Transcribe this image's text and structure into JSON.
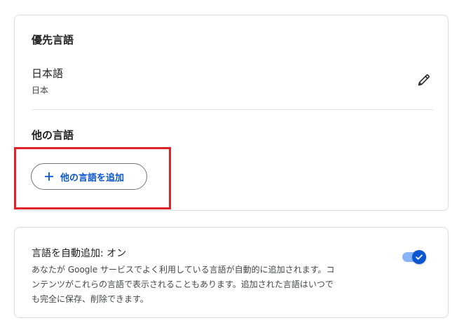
{
  "preferred": {
    "title": "優先言語",
    "language": "日本語",
    "region": "日本",
    "edit_icon": "pencil-icon"
  },
  "other": {
    "title": "他の言語",
    "add_button_label": "他の言語を追加",
    "add_icon": "plus-icon"
  },
  "auto_add": {
    "title": "言語を自動追加: オン",
    "description_lines": [
      "あなたが Google サービスでよく利用している言語が自動的に追加されます。コ",
      "ンテンツがこれらの言語で表示されることもあります。追加された言語はいつで",
      "も完全に保存、削除できます。"
    ],
    "toggle_on": true
  },
  "colors": {
    "accent": "#0b57d0",
    "highlight": "#e0232b",
    "toggle_track": "#8ab4f8",
    "border": "#dadce0"
  }
}
